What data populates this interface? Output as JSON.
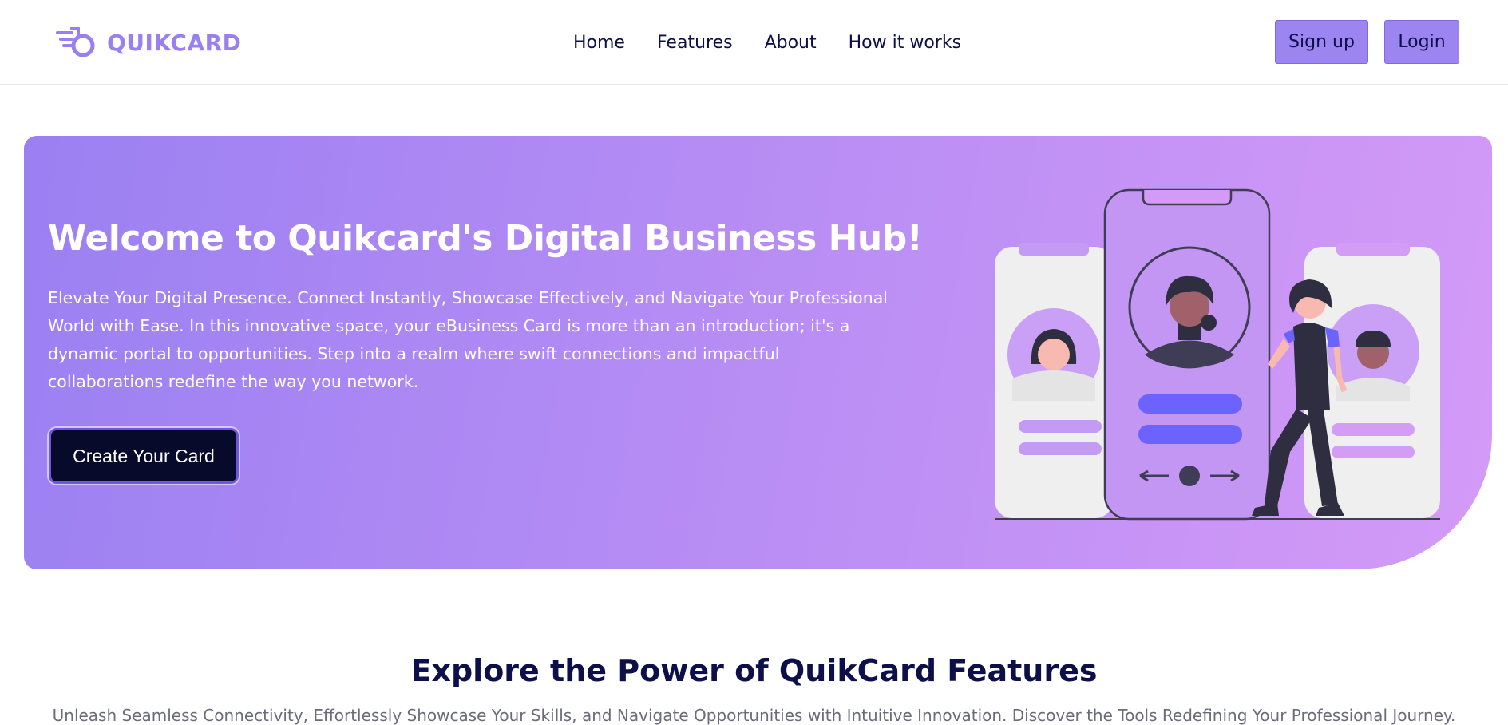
{
  "brand": {
    "name": "QUIKCARD",
    "logo_icon": "quikcard-logo-icon",
    "color": "#9a7ff0"
  },
  "nav": {
    "items": [
      {
        "label": "Home"
      },
      {
        "label": "Features"
      },
      {
        "label": "About"
      },
      {
        "label": "How it works"
      }
    ]
  },
  "header_actions": {
    "signup_label": "Sign up",
    "login_label": "Login"
  },
  "hero": {
    "title": "Welcome to Quikcard's Digital Business Hub!",
    "text": "Elevate Your Digital Presence. Connect Instantly, Showcase Effectively, and Navigate Your Professional World with Ease. In this innovative space, your eBusiness Card is more than an introduction; it's a dynamic portal to opportunities. Step into a realm where swift connections and impactful collaborations redefine the way you network.",
    "cta_label": "Create Your Card",
    "gradient_start": "#9b80f2",
    "gradient_end": "#d49af7"
  },
  "features": {
    "title": "Explore the Power of QuikCard Features",
    "subtitle": "Unleash Seamless Connectivity, Effortlessly Showcase Your Skills, and Navigate Opportunities with Intuitive Innovation. Discover the Tools Redefining Your Professional Journey."
  }
}
